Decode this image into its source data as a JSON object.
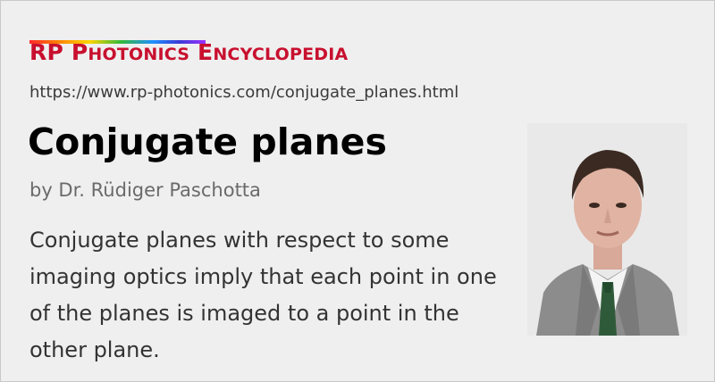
{
  "brand": {
    "prefix": "RP ",
    "word1_initial": "P",
    "word1_rest": "HOTONICS",
    "word2_initial": "E",
    "word2_rest": "NCYCLOPEDIA"
  },
  "url": "https://www.rp-photonics.com/conjugate_planes.html",
  "title": "Conjugate planes",
  "author": "by Dr. Rüdiger Paschotta",
  "description": "Conjugate planes with respect to some imaging optics imply that each point in one of the planes is imaged to a point in the other plane.",
  "photo": {
    "icon": "author-portrait-photo"
  },
  "colors": {
    "brand_red": "#c8102e",
    "background": "#efefef"
  }
}
